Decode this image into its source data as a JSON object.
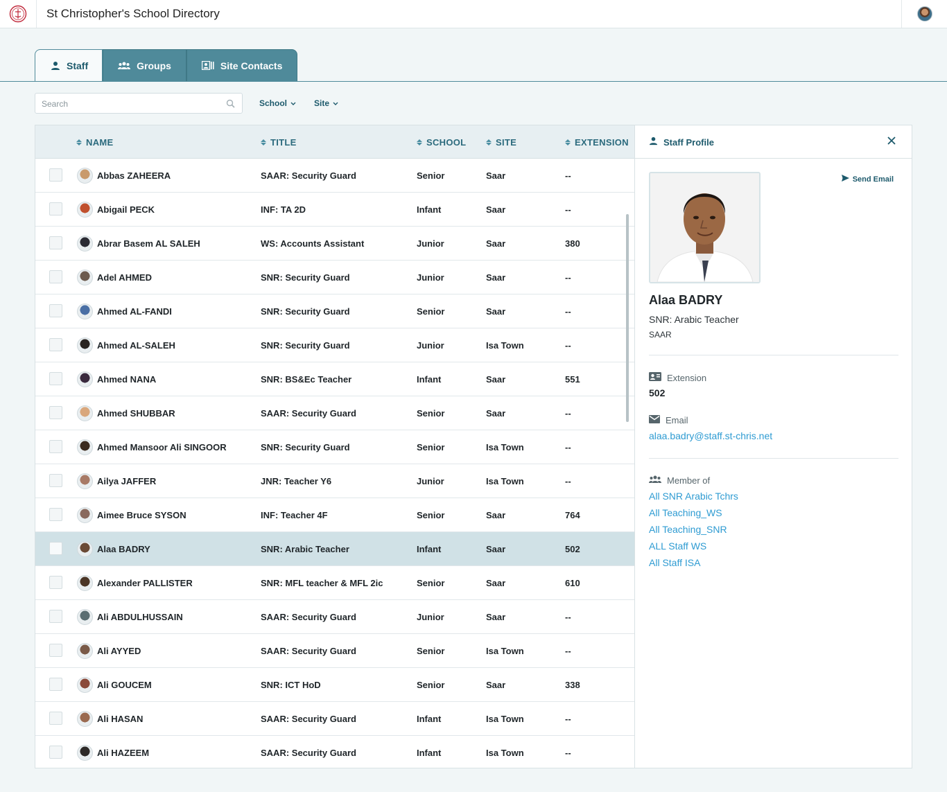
{
  "app": {
    "title": "St Christopher's School Directory"
  },
  "tabs": [
    {
      "label": "Staff",
      "icon": "person-icon"
    },
    {
      "label": "Groups",
      "icon": "group-icon"
    },
    {
      "label": "Site Contacts",
      "icon": "contact-card-icon"
    }
  ],
  "filters": {
    "search_placeholder": "Search",
    "school_label": "School",
    "site_label": "Site"
  },
  "table": {
    "columns": [
      "NAME",
      "TITLE",
      "SCHOOL",
      "SITE",
      "EXTENSION"
    ],
    "rows": [
      {
        "name": "Abbas ZAHEERA",
        "title": "SAAR: Security Guard",
        "school": "Senior",
        "site": "Saar",
        "ext": "--",
        "avatar": "#c99a6b"
      },
      {
        "name": "Abigail PECK",
        "title": "INF: TA 2D",
        "school": "Infant",
        "site": "Saar",
        "ext": "--",
        "avatar": "#c0502e"
      },
      {
        "name": "Abrar Basem AL SALEH",
        "title": "WS: Accounts Assistant",
        "school": "Junior",
        "site": "Saar",
        "ext": "380",
        "avatar": "#2b2b33"
      },
      {
        "name": "Adel AHMED",
        "title": "SNR: Security Guard",
        "school": "Junior",
        "site": "Saar",
        "ext": "--",
        "avatar": "#6b5a4e"
      },
      {
        "name": "Ahmed AL-FANDI",
        "title": "SNR: Security Guard",
        "school": "Senior",
        "site": "Saar",
        "ext": "--",
        "avatar": "#4a6fa5"
      },
      {
        "name": "Ahmed AL-SALEH",
        "title": "SNR: Security Guard",
        "school": "Junior",
        "site": "Isa Town",
        "ext": "--",
        "avatar": "#2a2420"
      },
      {
        "name": "Ahmed NANA",
        "title": "SNR: BS&Ec Teacher",
        "school": "Infant",
        "site": "Saar",
        "ext": "551",
        "avatar": "#3a2a3e"
      },
      {
        "name": "Ahmed SHUBBAR",
        "title": "SAAR: Security Guard",
        "school": "Senior",
        "site": "Saar",
        "ext": "--",
        "avatar": "#d9a77c"
      },
      {
        "name": "Ahmed Mansoor Ali SINGOOR",
        "title": "SNR: Security Guard",
        "school": "Senior",
        "site": "Isa Town",
        "ext": "--",
        "avatar": "#3b2b1f"
      },
      {
        "name": "Ailya JAFFER",
        "title": "JNR: Teacher Y6",
        "school": "Junior",
        "site": "Isa Town",
        "ext": "--",
        "avatar": "#a87a66"
      },
      {
        "name": "Aimee Bruce SYSON",
        "title": "INF: Teacher 4F",
        "school": "Senior",
        "site": "Saar",
        "ext": "764",
        "avatar": "#8a6a5e"
      },
      {
        "name": "Alaa BADRY",
        "title": "SNR: Arabic Teacher",
        "school": "Infant",
        "site": "Saar",
        "ext": "502",
        "avatar": "#6b4a35",
        "selected": true
      },
      {
        "name": "Alexander PALLISTER",
        "title": "SNR: MFL teacher & MFL 2ic",
        "school": "Senior",
        "site": "Saar",
        "ext": "610",
        "avatar": "#4b3626"
      },
      {
        "name": "Ali ABDULHUSSAIN",
        "title": "SAAR: Security Guard",
        "school": "Junior",
        "site": "Saar",
        "ext": "--",
        "avatar": "#5a6e72"
      },
      {
        "name": "Ali AYYED",
        "title": "SAAR: Security Guard",
        "school": "Senior",
        "site": "Isa Town",
        "ext": "--",
        "avatar": "#7a5a48"
      },
      {
        "name": "Ali GOUCEM",
        "title": "SNR: ICT HoD",
        "school": "Senior",
        "site": "Saar",
        "ext": "338",
        "avatar": "#8a4a3a"
      },
      {
        "name": "Ali HASAN",
        "title": "SAAR: Security Guard",
        "school": "Infant",
        "site": "Isa Town",
        "ext": "--",
        "avatar": "#9a6a50"
      },
      {
        "name": "Ali HAZEEM",
        "title": "SAAR: Security Guard",
        "school": "Infant",
        "site": "Isa Town",
        "ext": "--",
        "avatar": "#2e2a28"
      }
    ]
  },
  "profile": {
    "header": "Staff Profile",
    "send_email": "Send Email",
    "name": "Alaa BADRY",
    "title": "SNR: Arabic Teacher",
    "site": "SAAR",
    "extension_label": "Extension",
    "extension": "502",
    "email_label": "Email",
    "email": "alaa.badry@staff.st-chris.net",
    "member_label": "Member of",
    "groups": [
      "All SNR Arabic Tchrs",
      "All Teaching_WS",
      "All Teaching_SNR",
      "ALL Staff WS",
      "All Staff ISA"
    ]
  },
  "colors": {
    "accent": "#4f8a9a",
    "header_text": "#1d5a6c",
    "link": "#2e9bd2",
    "selected_row": "#d0e1e6"
  }
}
